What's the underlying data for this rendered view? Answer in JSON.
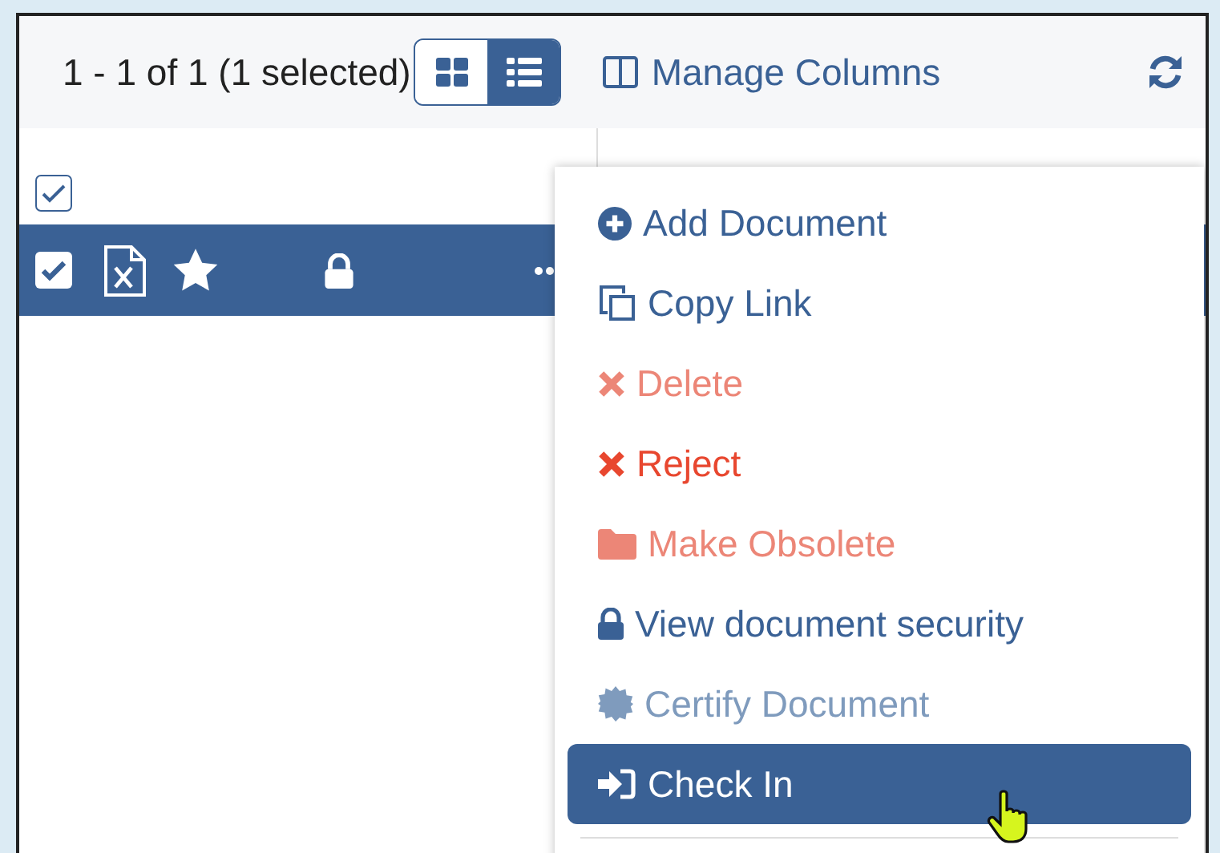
{
  "toolbar": {
    "count": "1 - 1 of 1 (1 selected)",
    "view_modes": [
      {
        "kind": "grid",
        "selected": false
      },
      {
        "kind": "list",
        "selected": true
      }
    ],
    "manage_columns": "Manage Columns"
  },
  "table": {
    "select_all_checked": true,
    "rows": [
      {
        "checked": true,
        "selected": true,
        "starred": true
      }
    ]
  },
  "menu": {
    "items": [
      {
        "kind": "add",
        "label": "Add Document",
        "danger": false,
        "disabled": false,
        "selected": false
      },
      {
        "kind": "copy",
        "label": "Copy Link",
        "danger": false,
        "disabled": false,
        "selected": false
      },
      {
        "kind": "delete",
        "label": "Delete",
        "danger": true,
        "disabled": true,
        "selected": false
      },
      {
        "kind": "reject",
        "label": "Reject",
        "danger": true,
        "disabled": false,
        "selected": false
      },
      {
        "kind": "obsolete",
        "label": "Make Obsolete",
        "danger": true,
        "disabled": true,
        "selected": false
      },
      {
        "kind": "security",
        "label": "View document security",
        "danger": false,
        "disabled": false,
        "selected": false
      },
      {
        "kind": "certify",
        "label": "Certify Document",
        "danger": false,
        "disabled": true,
        "selected": false
      },
      {
        "kind": "checkin",
        "label": "Check In",
        "danger": false,
        "disabled": false,
        "selected": true
      }
    ]
  }
}
